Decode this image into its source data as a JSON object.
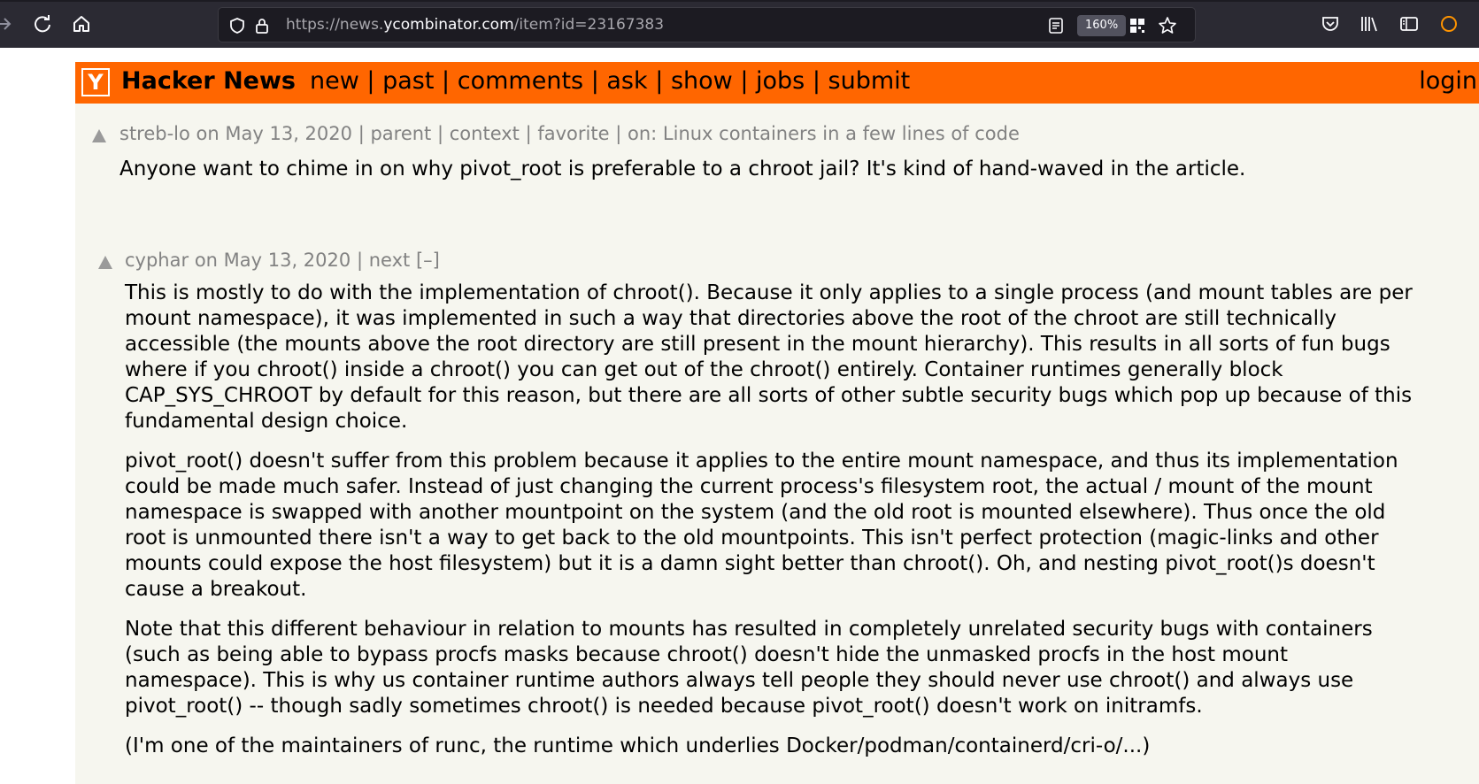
{
  "browser": {
    "url_prefix": "https://news.",
    "url_host": "ycombinator.com",
    "url_path": "/item?id=23167383",
    "zoom": "160%"
  },
  "header": {
    "logo_letter": "Y",
    "site_title": "Hacker News",
    "nav": [
      "new",
      "past",
      "comments",
      "ask",
      "show",
      "jobs",
      "submit"
    ],
    "login": "login"
  },
  "parent_comment": {
    "user": "streb-lo",
    "date": "on May 13, 2020",
    "links": [
      "parent",
      "context",
      "favorite"
    ],
    "on_label": "on:",
    "story_title": "Linux containers in a few lines of code",
    "text": "Anyone want to chime in on why pivot_root is preferable to a chroot jail? It's kind of hand-waved in the article."
  },
  "reply_comment": {
    "user": "cyphar",
    "date": "on May 13, 2020",
    "next": "next",
    "collapse": "[–]",
    "paragraphs": [
      "This is mostly to do with the implementation of chroot(). Because it only applies to a single process (and mount tables are per mount namespace), it was implemented in such a way that directories above the root of the chroot are still technically accessible (the mounts above the root directory are still present in the mount hierarchy). This results in all sorts of fun bugs where if you chroot() inside a chroot() you can get out of the chroot() entirely. Container runtimes generally block CAP_SYS_CHROOT by default for this reason, but there are all sorts of other subtle security bugs which pop up because of this fundamental design choice.",
      "pivot_root() doesn't suffer from this problem because it applies to the entire mount namespace, and thus its implementation could be made much safer. Instead of just changing the current process's filesystem root, the actual / mount of the mount namespace is swapped with another mountpoint on the system (and the old root is mounted elsewhere). Thus once the old root is unmounted there isn't a way to get back to the old mountpoints. This isn't perfect protection (magic-links and other mounts could expose the host filesystem) but it is a damn sight better than chroot(). Oh, and nesting pivot_root()s doesn't cause a breakout.",
      "Note that this different behaviour in relation to mounts has resulted in completely unrelated security bugs with containers (such as being able to bypass procfs masks because chroot() doesn't hide the unmasked procfs in the host mount namespace). This is why us container runtime authors always tell people they should never use chroot() and always use pivot_root() -- though sadly sometimes chroot() is needed because pivot_root() doesn't work on initramfs.",
      "(I'm one of the maintainers of runc, the runtime which underlies Docker/podman/containerd/cri-o/...)"
    ]
  },
  "colors": {
    "hn_orange": "#ff6600",
    "page_bg": "#f6f6ef",
    "meta_gray": "#828282"
  }
}
